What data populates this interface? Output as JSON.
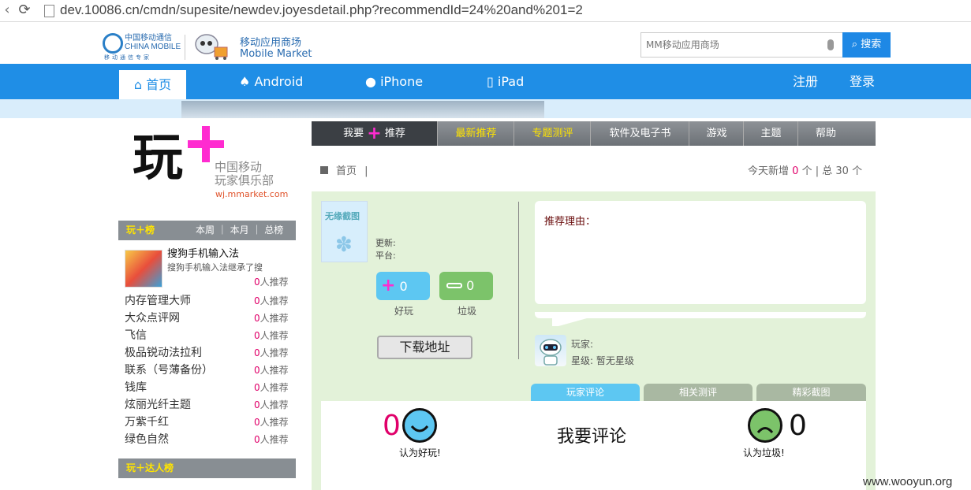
{
  "browser": {
    "url": "dev.10086.cn/cmdn/supesite/newdev.joyesdetail.php?recommendId=24%20and%201=2"
  },
  "header": {
    "cm_name_cn": "中国移动通信",
    "cm_name_en": "CHINA MOBILE",
    "cm_slogan": "移动通信专家",
    "mm_name_cn": "移动应用商场",
    "mm_name_en": "Mobile Market",
    "search_placeholder": "MM移动应用商场",
    "search_button": "搜索"
  },
  "nav": {
    "home": "首页",
    "android": "Android",
    "iphone": "iPhone",
    "ipad": "iPad",
    "register": "注册",
    "login": "登录"
  },
  "left": {
    "logo_big": "玩",
    "club_line1": "中国移动",
    "club_line2": "玩家俱乐部",
    "club_url": "wj.mmarket.com",
    "rank_title": "玩＋榜",
    "rank_tabs": "本周 ｜ 本月 ｜ 总榜",
    "featured": {
      "name": "搜狗手机输入法",
      "desc": "搜狗手机输入法继承了搜",
      "count": "0",
      "suffix": "人推荐"
    },
    "items": [
      {
        "name": "内存管理大师",
        "count": "0",
        "suffix": "人推荐"
      },
      {
        "name": "大众点评网",
        "count": "0",
        "suffix": "人推荐"
      },
      {
        "name": "飞信",
        "count": "0",
        "suffix": "人推荐"
      },
      {
        "name": "极品锐动法拉利",
        "count": "0",
        "suffix": "人推荐"
      },
      {
        "name": "联系（号薄备份）",
        "count": "0",
        "suffix": "人推荐"
      },
      {
        "name": "钱库",
        "count": "0",
        "suffix": "人推荐"
      },
      {
        "name": "炫丽光纤主题",
        "count": "0",
        "suffix": "人推荐"
      },
      {
        "name": "万紫千红",
        "count": "0",
        "suffix": "人推荐"
      },
      {
        "name": "绿色自然",
        "count": "0",
        "suffix": "人推荐"
      }
    ],
    "talent_title": "玩＋达人榜"
  },
  "tabs": {
    "recommend_pre": "我要",
    "recommend_post": "推荐",
    "latest": "最新推荐",
    "special": "专题测评",
    "software": "软件及电子书",
    "games": "游戏",
    "themes": "主题",
    "help": "帮助"
  },
  "crumb": {
    "home": "首页",
    "sep": "|"
  },
  "stats": {
    "pre": "今天新增",
    "today": "0",
    "mid": "个 | 总",
    "total": "30",
    "post": "个"
  },
  "app": {
    "icon_text": "无缘截图",
    "update_label": "更新:",
    "platform_label": "平台:",
    "good_count": "0",
    "bad_count": "0",
    "good_label": "好玩",
    "bad_label": "垃圾",
    "download": "下载地址"
  },
  "reason": {
    "label": "推荐理由："
  },
  "player": {
    "player_label": "玩家:",
    "stars_label": "星级: 暂无星级"
  },
  "comment_tabs": {
    "player_comments": "玩家评论",
    "related": "相关测评",
    "screenshots": "精彩截图"
  },
  "comment": {
    "good_count": "0",
    "good_label": "认为好玩!",
    "write": "我要评论",
    "bad_count": "0",
    "bad_label": "认为垃圾!"
  },
  "watermark": "www.wooyun.org",
  "colors": {
    "brand_blue": "#1f8ee6",
    "panel_green": "#e3f2d9",
    "accent_pink": "#e0006a",
    "highlight_yellow": "#ffe400"
  }
}
